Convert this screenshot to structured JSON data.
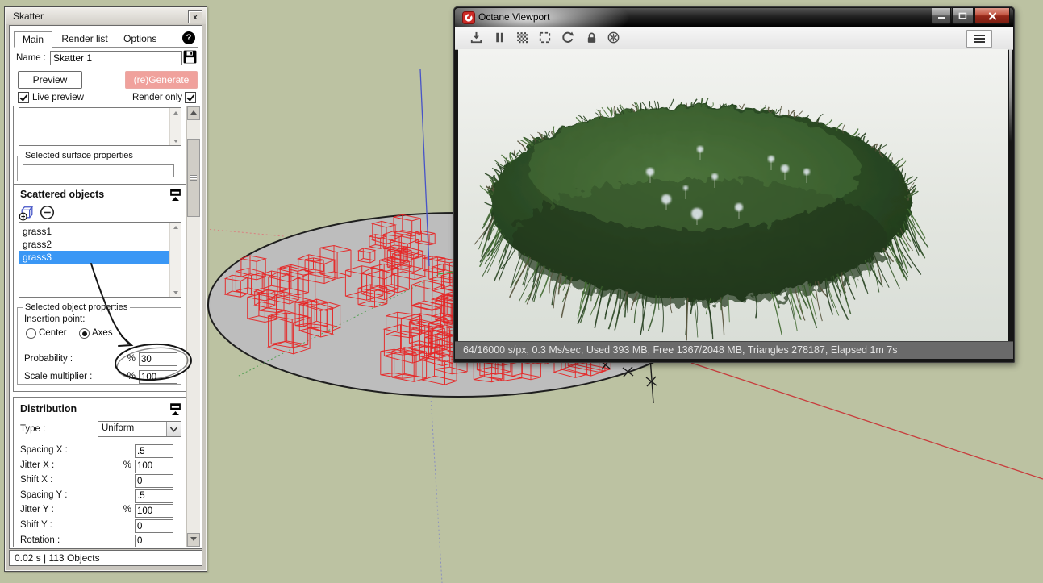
{
  "colors": {
    "selection_blue": "#3a97f5",
    "generate_pink": "#f0a19c",
    "octane_red": "#cc2b26",
    "sketchup_sage": "#bcc2a2",
    "surface_gray": "#bdbdbd",
    "wireframe_red": "#e62626",
    "status_bar_gray": "#6a6a6a"
  },
  "skatter_panel": {
    "title": "Skatter",
    "close_label": "x",
    "help_label": "?",
    "tabs": {
      "main": "Main",
      "render_list": "Render list",
      "options": "Options"
    },
    "name_label": "Name :",
    "name_value": "Skatter 1",
    "preview_button": "Preview",
    "generate_button": "(re)Generate",
    "live_preview_label": "Live preview",
    "render_only_label": "Render only",
    "surfaces_section": {
      "properties_legend": "Selected surface properties"
    },
    "scattered_objects": {
      "header": "Scattered objects",
      "items": [
        {
          "label": "grass1"
        },
        {
          "label": "grass2"
        },
        {
          "label": "grass3"
        }
      ],
      "selected_item": "grass3",
      "properties_legend": "Selected object properties",
      "insertion_point_label": "Insertion point:",
      "radio_center_label": "Center",
      "radio_axes_label": "Axes",
      "insertion_point_value": "Axes",
      "probability_label": "Probability :",
      "probability_prefix": "%",
      "probability_value": "30",
      "scale_label": "Scale multiplier :",
      "scale_prefix": "%",
      "scale_value": "100"
    },
    "distribution": {
      "header": "Distribution",
      "type_label": "Type :",
      "type_value": "Uniform",
      "rows": [
        {
          "label": "Spacing X :",
          "prefix": "",
          "value": ".5"
        },
        {
          "label": "Jitter X :",
          "prefix": "%",
          "value": "100"
        },
        {
          "label": "Shift X :",
          "prefix": "",
          "value": "0"
        },
        {
          "label": "Spacing Y :",
          "prefix": "",
          "value": ".5"
        },
        {
          "label": "Jitter Y :",
          "prefix": "%",
          "value": "100"
        },
        {
          "label": "Shift Y :",
          "prefix": "",
          "value": "0"
        },
        {
          "label": "Rotation :",
          "prefix": "",
          "value": "0"
        }
      ]
    },
    "status_bar": "0.02 s | 113 Objects"
  },
  "octane_window": {
    "title": "Octane Viewport",
    "window_buttons": [
      "minimize",
      "maximize",
      "close"
    ],
    "toolbar_icon_names": [
      "save-icon",
      "pause-icon",
      "dither-icon",
      "region-icon",
      "refresh-icon",
      "lock-icon",
      "kernel-icon",
      "menu-icon"
    ],
    "status_text": "64/16000 s/px, 0.3 Ms/sec, Used 393 MB, Free 1367/2048 MB, Triangles 278187, Elapsed 1m 7s"
  }
}
